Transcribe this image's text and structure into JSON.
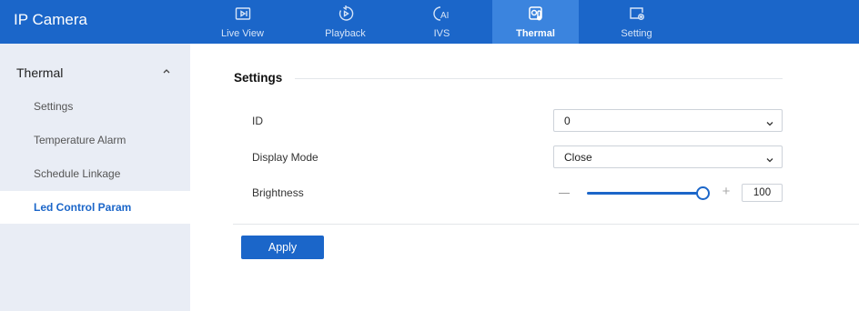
{
  "app": {
    "title": "IP Camera"
  },
  "nav": [
    {
      "label": "Live View",
      "icon": "live-view-icon",
      "active": false
    },
    {
      "label": "Playback",
      "icon": "playback-icon",
      "active": false
    },
    {
      "label": "IVS",
      "icon": "ivs-icon",
      "active": false
    },
    {
      "label": "Thermal",
      "icon": "thermal-icon",
      "active": true
    },
    {
      "label": "Setting",
      "icon": "setting-icon",
      "active": false
    }
  ],
  "sidebar": {
    "header": "Thermal",
    "items": [
      {
        "label": "Settings",
        "active": false
      },
      {
        "label": "Temperature Alarm",
        "active": false
      },
      {
        "label": "Schedule Linkage",
        "active": false
      },
      {
        "label": "Led Control Param",
        "active": true
      }
    ]
  },
  "main": {
    "section_title": "Settings",
    "fields": {
      "id": {
        "label": "ID",
        "value": "0"
      },
      "display_mode": {
        "label": "Display Mode",
        "value": "Close"
      },
      "brightness": {
        "label": "Brightness",
        "value": "100",
        "level": 1.0
      }
    },
    "apply_label": "Apply"
  },
  "colors": {
    "brand": "#1b66c9",
    "nav_active": "#3b84de",
    "sidebar_bg": "#e9edf5"
  }
}
